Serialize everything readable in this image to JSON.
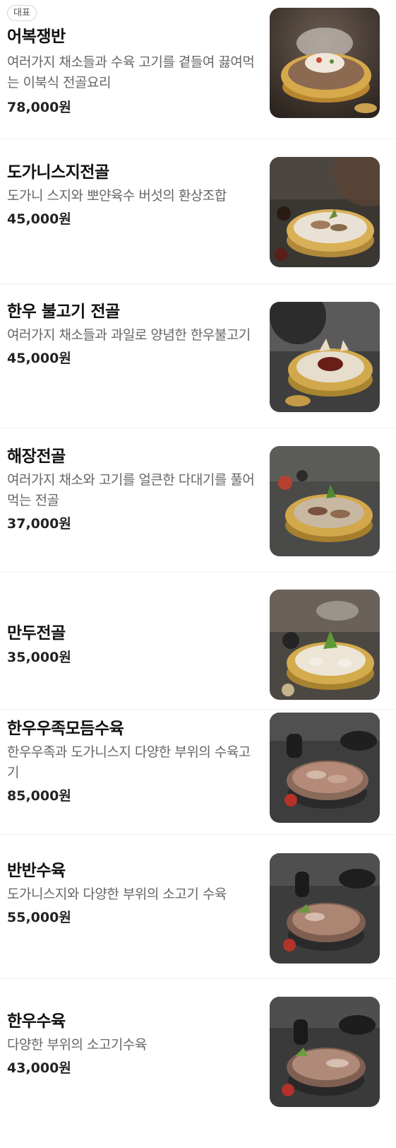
{
  "menu": {
    "items": [
      {
        "badge": "대표",
        "name": "어복쟁반",
        "desc": "여러가지 채소들과 수육 고기를 곁들여 끓여먹는 이북식 전골요리",
        "price": "78,000원",
        "image": "hot-pot-food-photo"
      },
      {
        "name": "도가니스지전골",
        "desc": "도가니 스지와 뽀얀육수 버섯의 환상조합",
        "price": "45,000원",
        "image": "hot-pot-food-photo"
      },
      {
        "name": "한우 불고기 전골",
        "desc": "여러가지 채소들과 과일로 양념한 한우불고기",
        "price": "45,000원",
        "image": "hot-pot-food-photo"
      },
      {
        "name": "해장전골",
        "desc": "여러가지 채소와 고기를 얼큰한 다대기를 풀어 먹는 전골",
        "price": "37,000원",
        "image": "hot-pot-food-photo"
      },
      {
        "name": "만두전골",
        "price": "35,000원",
        "image": "hot-pot-food-photo"
      },
      {
        "name": "한우우족모듬수육",
        "desc": "한우우족과 도가니스지 다양한 부위의 수육고기",
        "price": "85,000원",
        "image": "sliced-beef-platter-photo"
      },
      {
        "name": "반반수육",
        "desc": "도가니스지와 다양한 부위의 소고기 수육",
        "price": "55,000원",
        "image": "sliced-beef-platter-photo"
      },
      {
        "name": "한우수육",
        "desc": "다양한 부위의 소고기수육",
        "price": "43,000원",
        "image": "sliced-beef-platter-photo"
      }
    ]
  }
}
